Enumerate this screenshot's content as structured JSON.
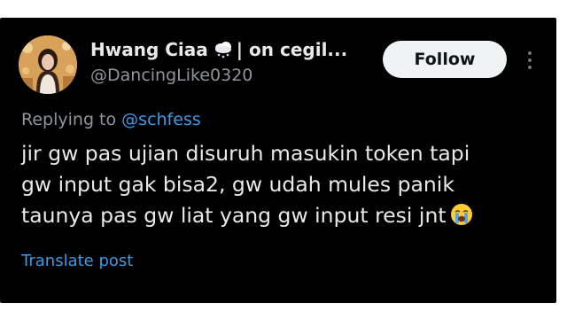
{
  "author": {
    "display_name": "Hwang Ciaa",
    "name_suffix": "| on cegil...",
    "handle": "@DancingLike0320",
    "status_icon": "cloud-snow-icon",
    "avatar_icon": "avatar-photo"
  },
  "actions": {
    "follow_label": "Follow",
    "more_icon": "more-vertical-icon"
  },
  "reply": {
    "prefix": "Replying to",
    "mention": "@schfess"
  },
  "post": {
    "lines": [
      "jir gw pas ujian disuruh masukin token tapi",
      "gw input gak bisa2, gw udah mules panik",
      "taunya pas gw liat yang gw input resi jnt"
    ],
    "trailing_emoji": "loudly-crying-face-icon"
  },
  "translate_label": "Translate post",
  "colors": {
    "background": "#000000",
    "text_primary": "#e7e9ea",
    "text_secondary": "#8f959a",
    "link": "#3b9ae6",
    "follow_bg": "#eff3f4"
  }
}
